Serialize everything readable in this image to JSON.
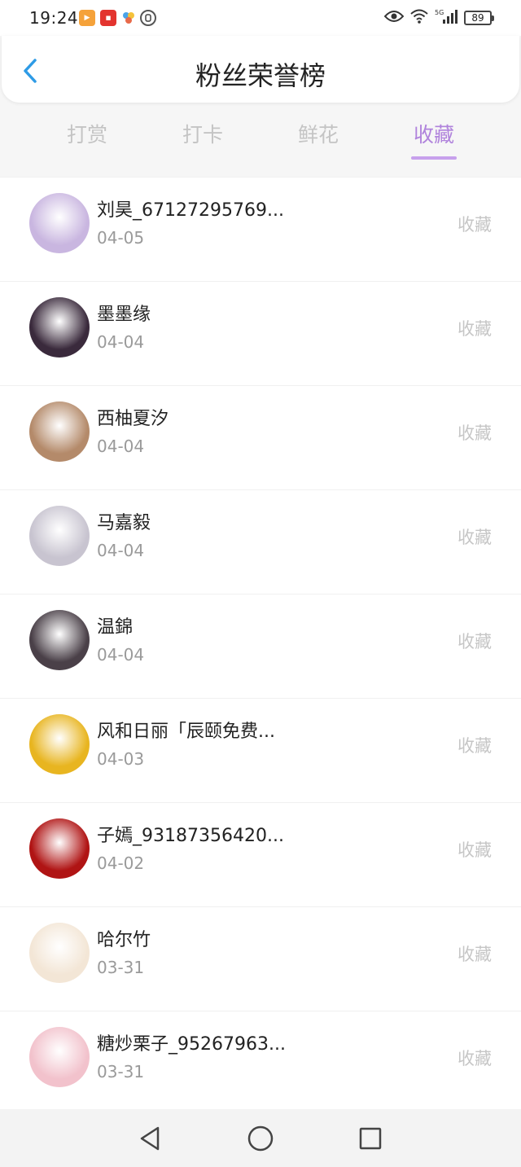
{
  "status": {
    "time": "19:24",
    "battery": "89",
    "notif_icons": [
      "video-app-icon",
      "news-app-icon",
      "pinwheel-app-icon",
      "hand-app-icon"
    ],
    "right_icons": [
      "eye-icon",
      "wifi-icon",
      "signal-icon",
      "battery-icon"
    ],
    "network_label": "5G"
  },
  "header": {
    "title": "粉丝荣誉榜"
  },
  "tabs": [
    {
      "label": "打赏",
      "active": false
    },
    {
      "label": "打卡",
      "active": false
    },
    {
      "label": "鲜花",
      "active": false
    },
    {
      "label": "收藏",
      "active": true
    }
  ],
  "accent_color": "#b083dc",
  "list": [
    {
      "name": "刘昊_67127295769...",
      "date": "04-05",
      "action": "收藏",
      "avatar_color": "#c9b6e0"
    },
    {
      "name": "墨墨缘",
      "date": "04-04",
      "action": "收藏",
      "avatar_color": "#3a2a3c"
    },
    {
      "name": "西柚夏汐",
      "date": "04-04",
      "action": "收藏",
      "avatar_color": "#b48a6a"
    },
    {
      "name": "马嘉毅",
      "date": "04-04",
      "action": "收藏",
      "avatar_color": "#c8c4d0"
    },
    {
      "name": "温錦",
      "date": "04-04",
      "action": "收藏",
      "avatar_color": "#4a4048"
    },
    {
      "name": "风和日丽「辰颐免费...",
      "date": "04-03",
      "action": "收藏",
      "avatar_color": "#e8b520"
    },
    {
      "name": "子嫣_93187356420...",
      "date": "04-02",
      "action": "收藏",
      "avatar_color": "#b01414"
    },
    {
      "name": "哈尔竹",
      "date": "03-31",
      "action": "收藏",
      "avatar_color": "#f3e6d6"
    },
    {
      "name": "糖炒栗子_95267963...",
      "date": "03-31",
      "action": "收藏",
      "avatar_color": "#f2c2cc"
    }
  ],
  "navbar": {
    "buttons": [
      "back-triangle-icon",
      "home-circle-icon",
      "recents-square-icon"
    ]
  }
}
